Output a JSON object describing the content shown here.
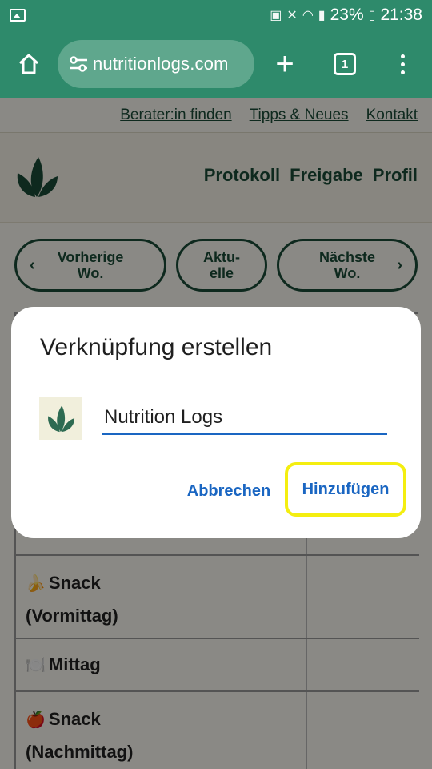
{
  "status_bar": {
    "battery": "23%",
    "time": "21:38"
  },
  "browser": {
    "url": "nutritionlogs.com",
    "tab_count": "1"
  },
  "page": {
    "top_links": [
      "Berater:in finden",
      "Tipps & Neues",
      "Kontakt"
    ],
    "nav": [
      "Protokoll",
      "Freigabe",
      "Profil"
    ],
    "week_nav": {
      "prev_line1": "Vorherige",
      "prev_line2": "Wo.",
      "curr_line1": "Aktu-",
      "curr_line2": "elle",
      "next_line1": "Nächste",
      "next_line2": "Wo."
    },
    "rows": [
      {
        "emoji": "🍌",
        "line1": "Snack",
        "line2": "(Vormittag)"
      },
      {
        "emoji": "🍽️",
        "line1": "Mittag",
        "line2": ""
      },
      {
        "emoji": "🍎",
        "line1": "Snack",
        "line2": "(Nachmittag)"
      }
    ]
  },
  "dialog": {
    "title": "Verknüpfung erstellen",
    "name_value": "Nutrition Logs",
    "cancel_label": "Abbrechen",
    "add_label": "Hinzufügen"
  },
  "colors": {
    "brand_green": "#2e8a6b",
    "dark_green": "#1b4c38",
    "link_blue": "#1a66c2",
    "highlight": "#f4ee10"
  }
}
